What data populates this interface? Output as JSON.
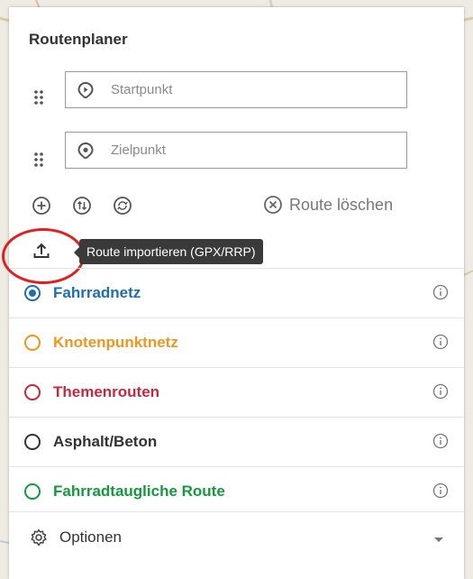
{
  "planner": {
    "title": "Routenplaner",
    "start_placeholder": "Startpunkt",
    "end_placeholder": "Zielpunkt",
    "clear_label": "Route löschen",
    "import_tooltip": "Route importieren (GPX/RRP)"
  },
  "networks": [
    {
      "label": "Fahrradnetz",
      "color": "#1f6db5",
      "checked": true
    },
    {
      "label": "Knotenpunktnetz",
      "color": "#f0961e",
      "checked": false
    },
    {
      "label": "Themenrouten",
      "color": "#c7283c",
      "checked": false
    },
    {
      "label": "Asphalt/Beton",
      "color": "#333333",
      "checked": false
    },
    {
      "label": "Fahrradtaugliche Route",
      "color": "#16983e",
      "checked": false
    }
  ],
  "options": {
    "label": "Optionen"
  },
  "icons": {
    "drag": "drag-handle-icon",
    "start": "play-pin-icon",
    "end": "location-pin-icon",
    "add": "add-waypoint-icon",
    "reverse": "reverse-route-icon",
    "roundtrip": "roundtrip-icon",
    "clear": "close-circle-icon",
    "import": "upload-icon",
    "info": "info-icon",
    "settings": "gear-icon",
    "caret": "chevron-down-icon"
  },
  "highlight_color": "#e02020"
}
